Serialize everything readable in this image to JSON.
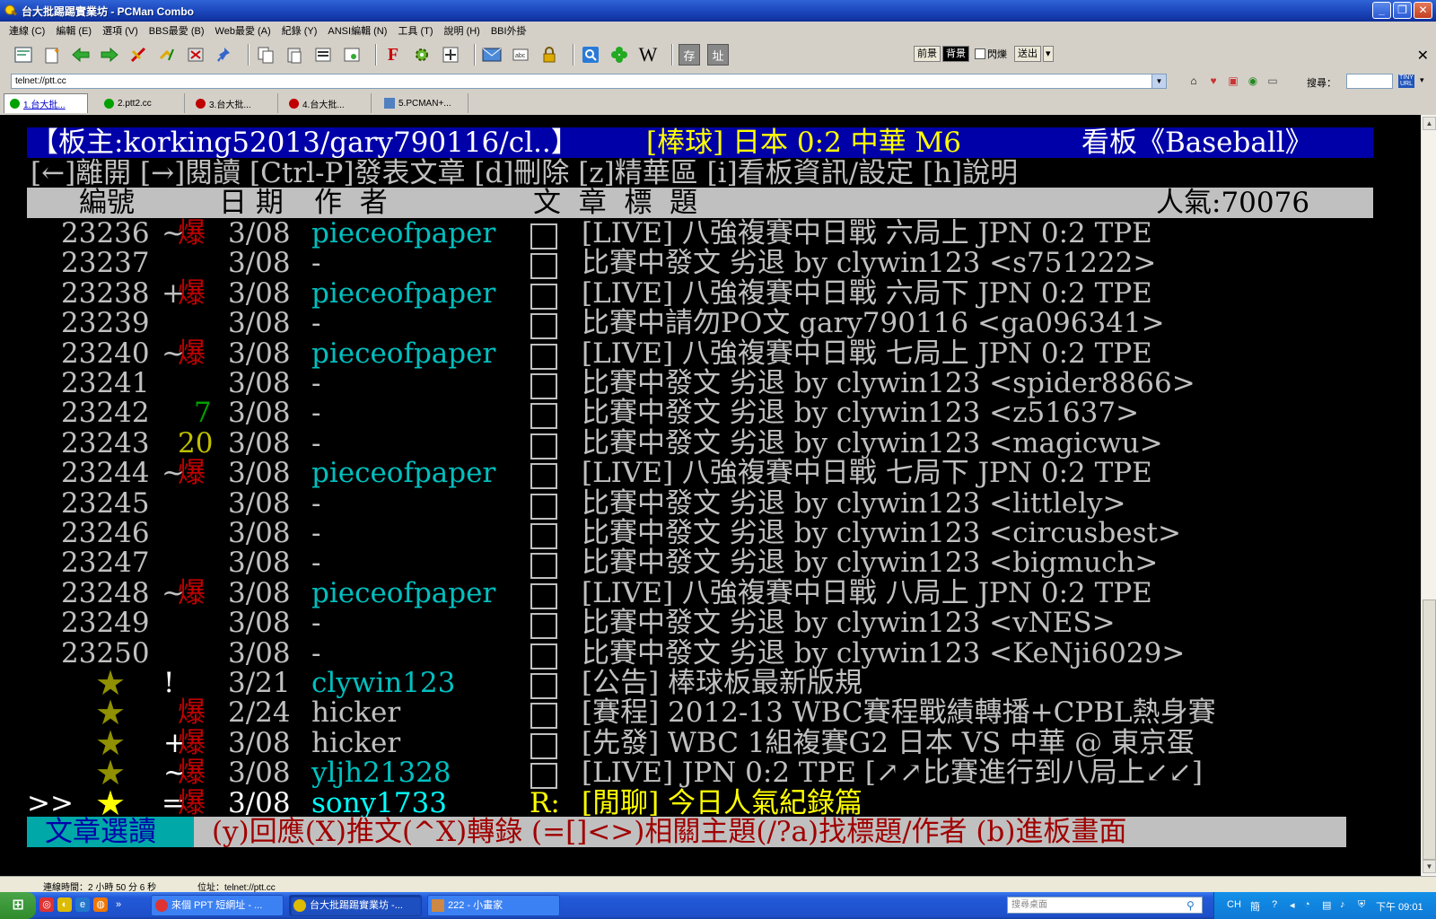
{
  "window": {
    "title": "台大批踢踢實業坊 - PCMan Combo"
  },
  "menubar": [
    "連線 (C)",
    "編輯 (E)",
    "選項 (V)",
    "BBS最愛 (B)",
    "Web最愛 (A)",
    "紀錄 (Y)",
    "ANSI編輯 (N)",
    "工具 (T)",
    "說明 (H)",
    "BBI外掛"
  ],
  "toolbar": {
    "icons": [
      "connect-icon",
      "new-icon",
      "back-icon",
      "forward-icon",
      "disconnect-icon",
      "reconnect-icon",
      "close-tab-icon",
      "pin-icon",
      "copy-icon",
      "paste-icon",
      "copy-ansi-icon",
      "screenshot-icon",
      "font-icon",
      "settings-icon",
      "resize-icon",
      "email-icon",
      "keymap-icon",
      "lock-icon",
      "search-icon",
      "clover-icon",
      "wikipedia-icon",
      "save-icon",
      "address-icon"
    ],
    "fg_label": "前景",
    "bg_label": "背景",
    "blink_label": "閃爍",
    "send_label": "送出"
  },
  "address": {
    "value": "telnet://ptt.cc",
    "search_label": "搜尋：",
    "tinyurl_label": "TINY URL"
  },
  "tabs": [
    {
      "label": "1.台大批...",
      "color": "#00a000"
    },
    {
      "label": "2.ptt2.cc",
      "color": "#00a000"
    },
    {
      "label": "3.台大批...",
      "color": "#c00000"
    },
    {
      "label": "4.台大批...",
      "color": "#c00000"
    },
    {
      "label": "5.PCMAN+...",
      "color": "#5080c0"
    }
  ],
  "terminal": {
    "header_left": "【板主:korking52013/gary790116/cl..】",
    "header_board": "[棒球] 日本 0:2 中華 M6",
    "header_right": "看板《Baseball》",
    "help_line": "[←]離開 [→]閱讀 [Ctrl-P]發表文章 [d]刪除 [z]精華區 [i]看板資訊/設定 [h]說明",
    "col_num": "編號",
    "col_date": "日 期",
    "col_author": "作  者",
    "col_title": "文  章  標  題",
    "popularity": "人氣:70076",
    "posts": [
      {
        "num": "23236",
        "mark": "~",
        "rec": "爆",
        "date": "3/08",
        "author": "pieceofpaper",
        "title": "[LIVE] 八強複賽中日戰 六局上 JPN 0:2 TPE"
      },
      {
        "num": "23237",
        "mark": "",
        "rec": "",
        "date": "3/08",
        "author": "-",
        "title": "比賽中發文 劣退 by clywin123 <s751222>"
      },
      {
        "num": "23238",
        "mark": "+",
        "rec": "爆",
        "date": "3/08",
        "author": "pieceofpaper",
        "title": "[LIVE] 八強複賽中日戰 六局下 JPN 0:2 TPE"
      },
      {
        "num": "23239",
        "mark": "",
        "rec": "",
        "date": "3/08",
        "author": "-",
        "title": "比賽中請勿PO文 gary790116 <ga096341>"
      },
      {
        "num": "23240",
        "mark": "~",
        "rec": "爆",
        "date": "3/08",
        "author": "pieceofpaper",
        "title": "[LIVE] 八強複賽中日戰 七局上 JPN 0:2 TPE"
      },
      {
        "num": "23241",
        "mark": "",
        "rec": "",
        "date": "3/08",
        "author": "-",
        "title": "比賽中發文 劣退 by clywin123 <spider8866>"
      },
      {
        "num": "23242",
        "mark": "",
        "rec": "7",
        "date": "3/08",
        "author": "-",
        "title": "比賽中發文 劣退 by clywin123 <z51637>"
      },
      {
        "num": "23243",
        "mark": "",
        "rec": "20",
        "date": "3/08",
        "author": "-",
        "title": "比賽中發文 劣退 by clywin123 <magicwu>"
      },
      {
        "num": "23244",
        "mark": "~",
        "rec": "爆",
        "date": "3/08",
        "author": "pieceofpaper",
        "title": "[LIVE] 八強複賽中日戰 七局下 JPN 0:2 TPE"
      },
      {
        "num": "23245",
        "mark": "",
        "rec": "",
        "date": "3/08",
        "author": "-",
        "title": "比賽中發文 劣退 by clywin123 <littlely>"
      },
      {
        "num": "23246",
        "mark": "",
        "rec": "",
        "date": "3/08",
        "author": "-",
        "title": "比賽中發文 劣退 by clywin123 <circusbest>"
      },
      {
        "num": "23247",
        "mark": "",
        "rec": "",
        "date": "3/08",
        "author": "-",
        "title": "比賽中發文 劣退 by clywin123 <bigmuch>"
      },
      {
        "num": "23248",
        "mark": "~",
        "rec": "爆",
        "date": "3/08",
        "author": "pieceofpaper",
        "title": "[LIVE] 八強複賽中日戰 八局上 JPN 0:2 TPE"
      },
      {
        "num": "23249",
        "mark": "",
        "rec": "",
        "date": "3/08",
        "author": "-",
        "title": "比賽中發文 劣退 by clywin123 <vNES>"
      },
      {
        "num": "23250",
        "mark": "",
        "rec": "",
        "date": "3/08",
        "author": "-",
        "title": "比賽中發文 劣退 by clywin123 <KeNji6029>"
      }
    ],
    "pinned": [
      {
        "star": "★",
        "mark": "!",
        "rec": "",
        "date": "3/21",
        "author": "clywin123",
        "title": "[公告] 棒球板最新版規"
      },
      {
        "star": "★",
        "mark": "",
        "rec": "爆",
        "date": "2/24",
        "author": "hicker",
        "title": "[賽程] 2012-13 WBC賽程戰績轉播+CPBL熱身賽"
      },
      {
        "star": "★",
        "mark": "+",
        "rec": "爆",
        "date": "3/08",
        "author": "hicker",
        "title": "[先發] WBC 1組複賽G2 日本 VS 中華 @ 東京蛋"
      },
      {
        "star": "★",
        "mark": "~",
        "rec": "爆",
        "date": "3/08",
        "author": "yljh21328",
        "title": "[LIVE] JPN 0:2 TPE [↗↗比賽進行到八局上↙↙]"
      }
    ],
    "selected": {
      "cursor": ">>",
      "star": "★",
      "mark": "=",
      "rec": "爆",
      "date": "3/08",
      "author": "sony1733",
      "prefix": "R:",
      "title": "[閒聊] 今日人氣紀錄篇"
    },
    "footer_mode": "文章選讀",
    "footer_help": "(y)回應(X)推文(^X)轉錄 (=[]<>)相關主題(/?a)找標題/作者 (b)進板畫面"
  },
  "statusbar": {
    "conn_time": "連線時間：2 小時 50 分 6 秒",
    "address": "位址：telnet://ptt.cc"
  },
  "taskbar": {
    "tasks": [
      {
        "label": "來個 PPT 短網址 - ..."
      },
      {
        "label": "台大批踢踢實業坊 -..."
      },
      {
        "label": "222 - 小畫家"
      }
    ],
    "search_placeholder": "搜尋桌面",
    "tray_lang": "CH",
    "tray_ime": "簡",
    "clock": "下午 09:01"
  }
}
